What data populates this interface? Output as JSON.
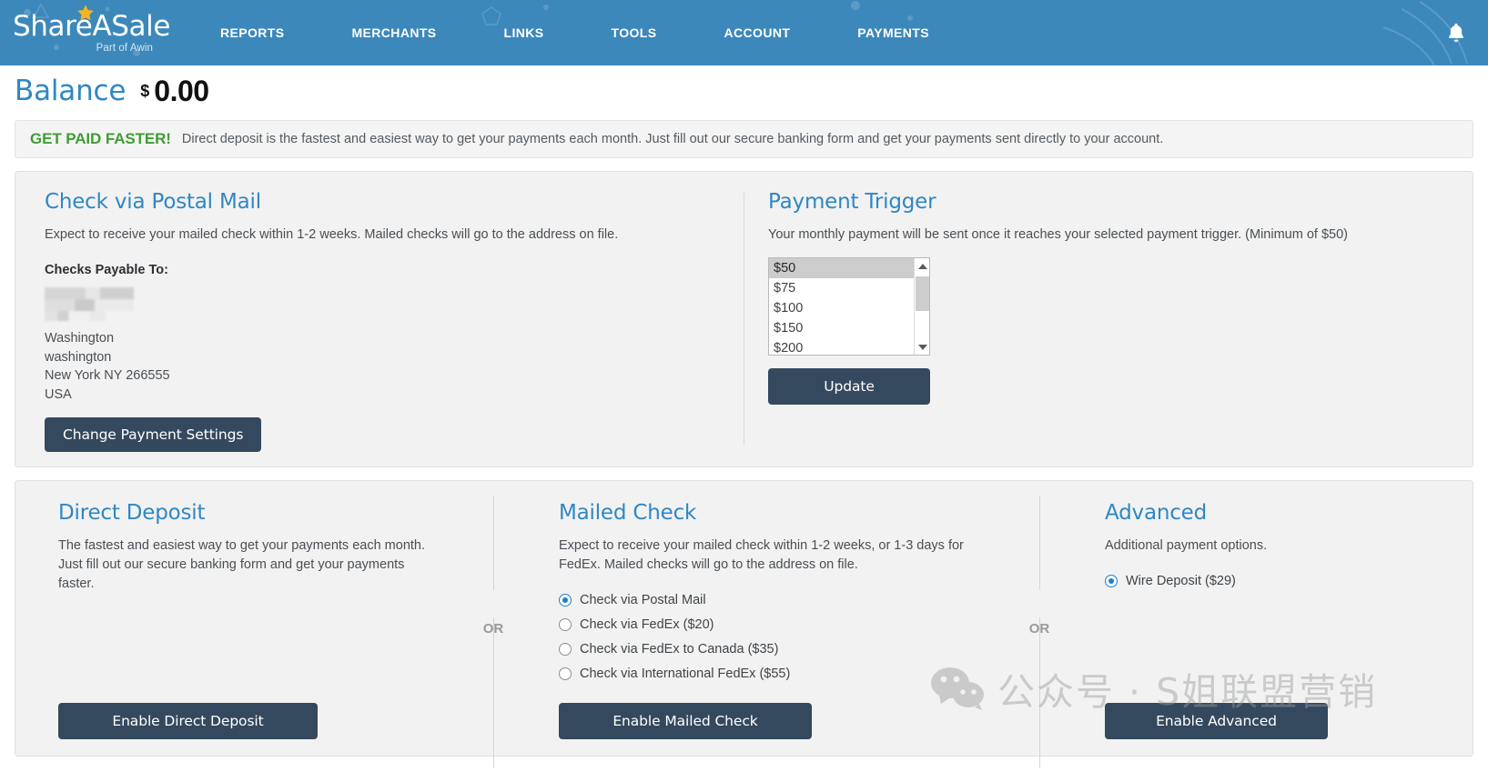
{
  "header": {
    "logo_text": "ShareASale",
    "logo_sub": "Part of Awin",
    "logo_star_icon": "star-icon",
    "bell_icon": "bell-icon",
    "nav": [
      {
        "label": "REPORTS"
      },
      {
        "label": "MERCHANTS"
      },
      {
        "label": "LINKS"
      },
      {
        "label": "TOOLS"
      },
      {
        "label": "ACCOUNT"
      },
      {
        "label": "PAYMENTS"
      }
    ]
  },
  "balance": {
    "label": "Balance",
    "currency": "$",
    "amount": "0.00"
  },
  "banner": {
    "strong": "GET PAID FASTER!",
    "text": "Direct deposit is the fastest and easiest way to get your payments each month. Just fill out our secure banking form and get your payments sent directly to your account."
  },
  "postal": {
    "title": "Check via Postal Mail",
    "description": "Expect to receive your mailed check within 1-2 weeks. Mailed checks will go to the address on file.",
    "payable_label": "Checks Payable To:",
    "address": [
      "Washington",
      "washington",
      "New York NY 266555",
      "USA"
    ],
    "button": "Change Payment Settings"
  },
  "trigger": {
    "title": "Payment Trigger",
    "description": "Your monthly payment will be sent once it reaches your selected payment trigger. (Minimum of $50)",
    "selected": "$50",
    "options": [
      "$50",
      "$75",
      "$100",
      "$150",
      "$200"
    ],
    "button": "Update"
  },
  "direct_deposit": {
    "title": "Direct Deposit",
    "description": "The fastest and easiest way to get your payments each month. Just fill out our secure banking form and get your payments faster.",
    "button": "Enable Direct Deposit"
  },
  "or_label": "OR",
  "mailed_check": {
    "title": "Mailed Check",
    "description": "Expect to receive your mailed check within 1-2 weeks, or 1-3 days for FedEx. Mailed checks will go to the address on file.",
    "options": [
      {
        "label": "Check via Postal Mail",
        "selected": true
      },
      {
        "label": "Check via FedEx ($20)",
        "selected": false
      },
      {
        "label": "Check via FedEx to Canada ($35)",
        "selected": false
      },
      {
        "label": "Check via International FedEx ($55)",
        "selected": false
      }
    ],
    "button": "Enable Mailed Check"
  },
  "advanced": {
    "title": "Advanced",
    "description": "Additional payment options.",
    "options": [
      {
        "label": "Wire Deposit ($29)",
        "selected": true
      }
    ],
    "button": "Enable Advanced"
  },
  "watermark": {
    "icon": "wechat-icon",
    "text": "公众号 · S姐联盟营销"
  },
  "colors": {
    "header_blue": "#3c88bb",
    "link_blue": "#2f87c4",
    "button_navy": "#35495e",
    "green": "#3f9c35",
    "radio_blue": "#1d7fd1",
    "card_bg": "#f2f2f2"
  }
}
